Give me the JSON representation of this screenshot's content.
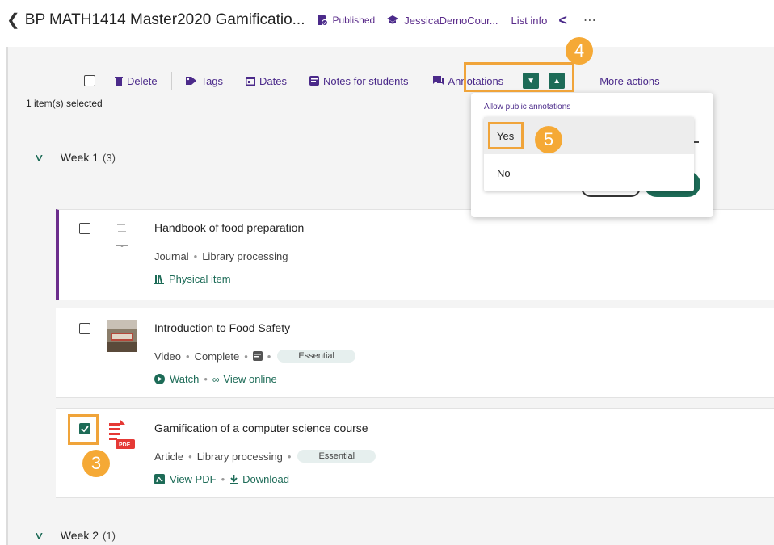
{
  "header": {
    "title": "BP MATH1414 Master2020 Gamificatio...",
    "published": "Published",
    "course": "JessicaDemoCour...",
    "list_info": "List info"
  },
  "toolbar": {
    "delete": "Delete",
    "tags": "Tags",
    "dates": "Dates",
    "notes": "Notes for students",
    "annotations": "Annotations",
    "more_actions": "More actions",
    "selected_count": "1 item(s) selected"
  },
  "dropdown": {
    "label": "Allow public annotations",
    "options": [
      "Yes",
      "No"
    ]
  },
  "callouts": {
    "step3": "3",
    "step4": "4",
    "step5": "5"
  },
  "weeks": [
    {
      "label": "Week 1",
      "count": "(3)"
    },
    {
      "label": "Week 2",
      "count": "(1)"
    }
  ],
  "items": [
    {
      "title": "Handbook of food preparation",
      "type": "Journal",
      "status": "Library processing",
      "link1": "Physical item"
    },
    {
      "title": "Introduction to Food Safety",
      "type": "Video",
      "status": "Complete",
      "tag": "Essential",
      "link1": "Watch",
      "link2": "View online"
    },
    {
      "title": "Gamification of a computer science course",
      "type": "Article",
      "status": "Library processing",
      "tag": "Essential",
      "link1": "View PDF",
      "link2": "Download",
      "pdf_label": "PDF"
    }
  ],
  "colors": {
    "accent_green": "#1d6b57",
    "accent_purple": "#4b2a8a",
    "callout_orange": "#f5a936"
  }
}
